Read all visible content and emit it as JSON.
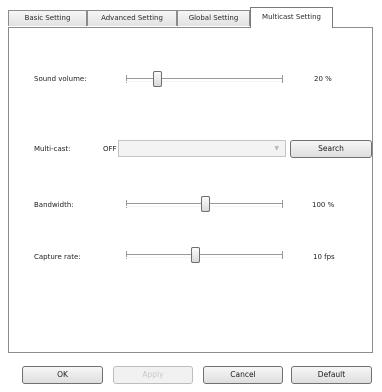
{
  "tabs": [
    {
      "label": "Basic Setting"
    },
    {
      "label": "Advanced Setting"
    },
    {
      "label": "Global Setting"
    },
    {
      "label": "Multicast Setting",
      "active": true
    }
  ],
  "multicast_panel": {
    "sound_volume": {
      "label": "Sound volume:",
      "value": "20 %",
      "level": 0.2
    },
    "multicast": {
      "label": "Multi-cast:",
      "state": "OFF",
      "selected": "",
      "search_label": "Search"
    },
    "bandwidth": {
      "label": "Bandwidth:",
      "value": "100 %",
      "level": 0.5
    },
    "capture_rate": {
      "label": "Capture rate:",
      "value": "10 fps",
      "level": 0.44
    }
  },
  "footer": {
    "ok_label": "OK",
    "apply_label": "Apply",
    "cancel_label": "Cancel",
    "default_label": "Default"
  }
}
